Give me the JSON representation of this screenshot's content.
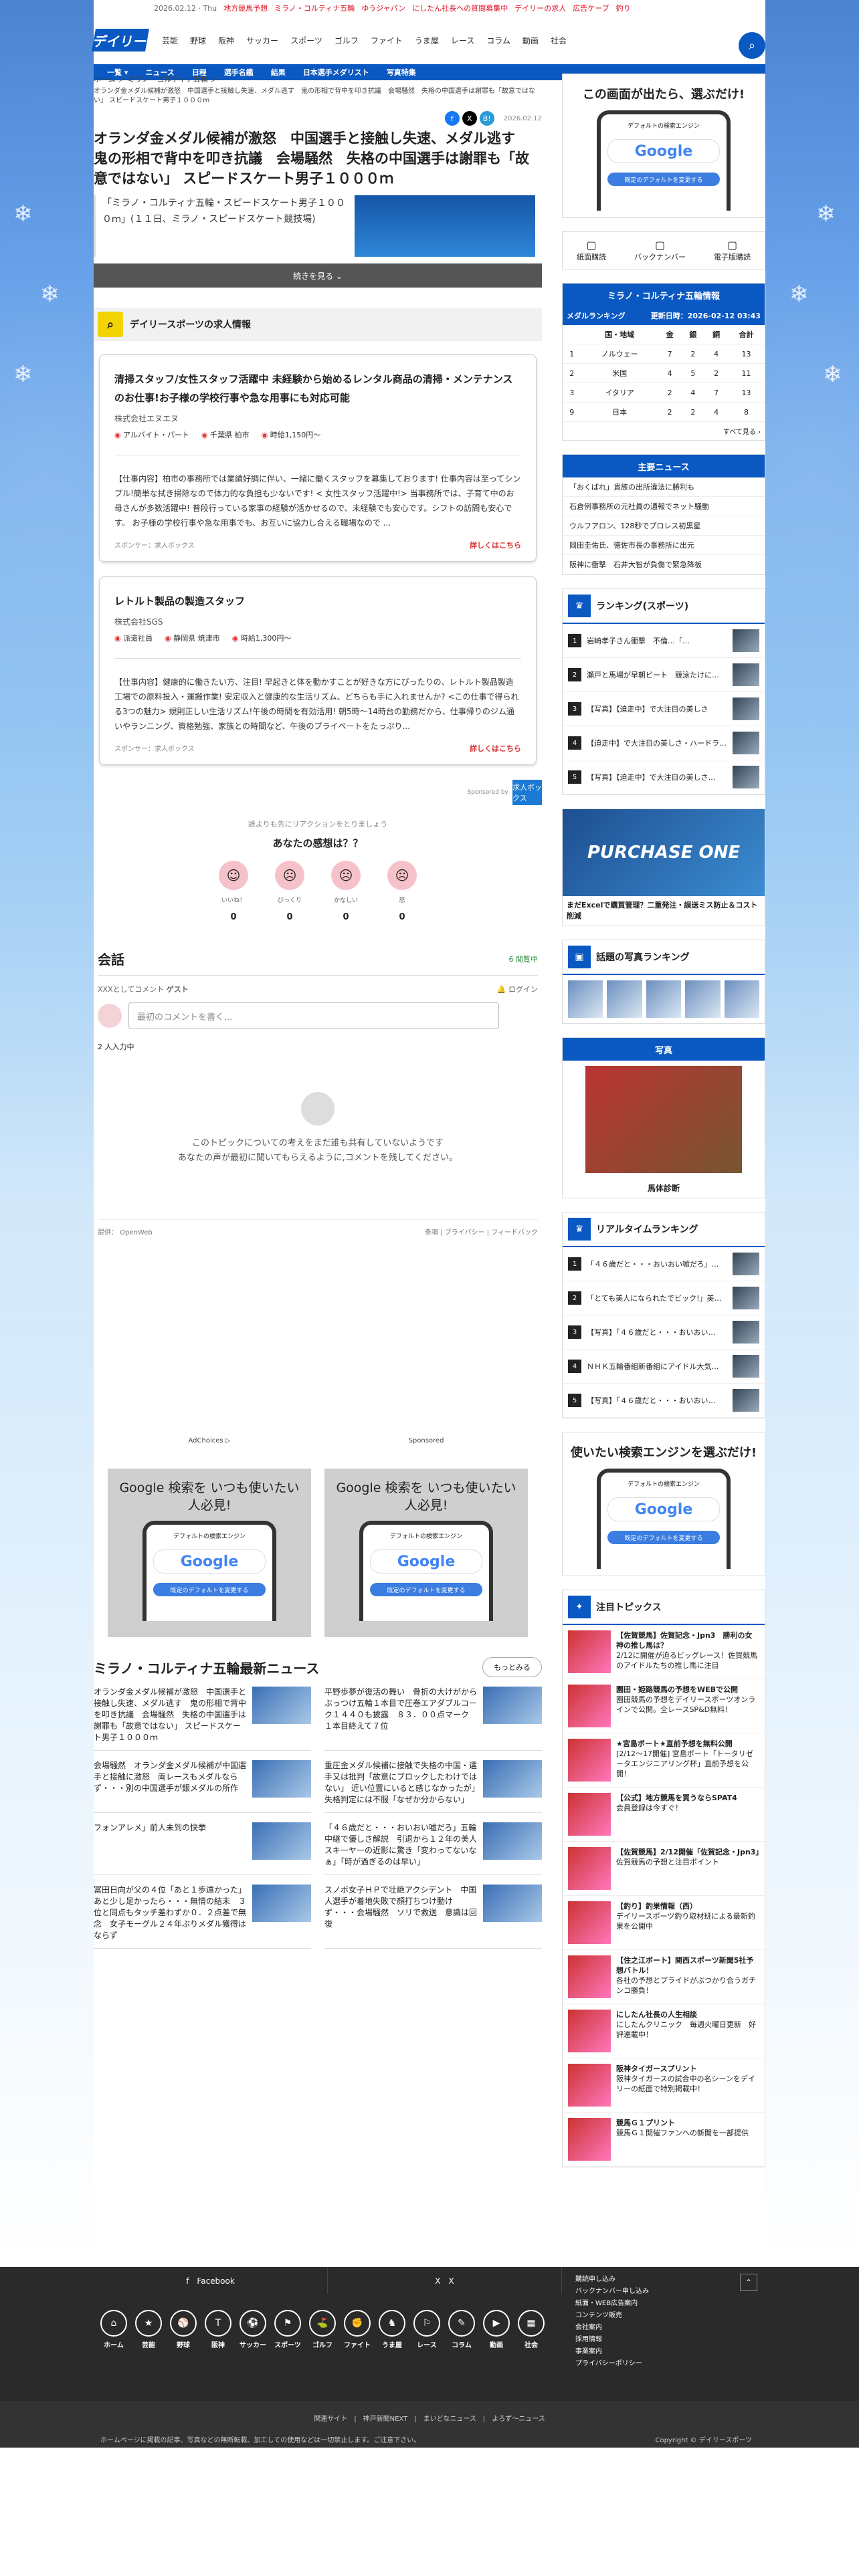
{
  "topbar": {
    "date": "2026.02.12 · Thu",
    "links": [
      "地方競馬予想",
      "ミラノ・コルティナ五輪",
      "ゆうジャパン",
      "にしたん社長への質問募集中",
      "デイリーの求人",
      "広告ケーブ",
      "釣り"
    ]
  },
  "header": {
    "logo": "デイリー",
    "nav": [
      "芸能",
      "野球",
      "阪神",
      "サッカー",
      "スポーツ",
      "ゴルフ",
      "ファイト",
      "うま屋",
      "レース",
      "コラム",
      "動画",
      "社会"
    ]
  },
  "subnav": [
    "一覧 ▾",
    "ニュース",
    "日程",
    "選手名鑑",
    "結果",
    "日本選手メダリスト",
    "写真特集"
  ],
  "article": {
    "breadcrumb": "ホーム ＞ ミラノ・コルティナ五輪 ＞",
    "intro": "オランダ金メダル候補が激怒　中国選手と接触し失速、メダル逃す　鬼の形相で背中を叩き抗議　会場騒然　失格の中国選手は謝罪も「故意ではない」 スピードスケート男子１０００ｍ",
    "date": "2026.02.12",
    "title": "オランダ金メダル候補が激怒　中国選手と接触し失速、メダル逃す　鬼の形相で背中を叩き抗議　会場騒然　失格の中国選手は謝罪も「故意ではない」 スピードスケート男子１０００ｍ",
    "lead": "「ミラノ・コルティナ五輪・スピードスケート男子１０００ｍ」(１１日、ミラノ・スピードスケート競技場)",
    "more": "続きを見る ⌄"
  },
  "jobs": {
    "heading": "デイリースポーツの求人情報",
    "items": [
      {
        "title": "清掃スタッフ/女性スタッフ活躍中 未経験から始めるレンタル商品の清掃・メンテナンスのお仕事!お子様の学校行事や急な用事にも対応可能",
        "company": "株式会社エヌエヌ",
        "type": "アルバイト・パート",
        "place": "千葉県 柏市",
        "wage": "時給1,150円〜",
        "desc": "【仕事内容】柏市の事務所では業績好調に伴い、一緒に働くスタッフを募集しております! 仕事内容は至ってシンプル!簡単な拭き掃除なので体力的な負担も少ないです! < 女性スタッフ活躍中!> 当事務所では、子育て中のお母さんが多数活躍中! 普段行っている家事の経験が活かせるので、未経験でも安心です。シフトの訪問も安心です。 お子様の学校行事や急な用事でも、お互いに協力し合える職場なので ...",
        "sponsor": "スポンサー：求人ボックス",
        "more": "詳しくはこちら"
      },
      {
        "title": "レトルト製品の製造スタッフ",
        "company": "株式会社SGS",
        "type": "派遣社員",
        "place": "静岡県 焼津市",
        "wage": "時給1,300円〜",
        "desc": "【仕事内容】健康的に働きたい方、注目! 早起きと体を動かすことが好きな方にぴったりの、レトルト製品製造工場での原料投入・運搬作業! 安定収入と健康的な生活リズム、どちらも手に入れませんか? <この仕事で得られる3つの魅力> 規則正しい生活リズム!午後の時間を有効活用! 朝5時〜14時台の勤務だから、仕事帰りのジム通いやランニング、資格勉強、家族との時間など、午後のプライベートをたっぷり...",
        "sponsor": "スポンサー：求人ボックス",
        "more": "詳しくはこちら"
      }
    ],
    "sponsored": "Sponsored by",
    "badge": "求人ボックス"
  },
  "reactions": {
    "sub": "誰よりも先にリアクションをとりましょう",
    "title": "あなたの感想は？？",
    "items": [
      {
        "label": "いいね！",
        "count": "0"
      },
      {
        "label": "びっくり",
        "count": "0"
      },
      {
        "label": "かなしい",
        "count": "0"
      },
      {
        "label": "怒",
        "count": "0"
      }
    ]
  },
  "comments": {
    "title": "会話",
    "count": "6 閲覧中",
    "as": "XXXとしてコメント",
    "guest": "ゲスト",
    "login": "ログイン",
    "placeholder": "最初のコメントを書く...",
    "typing": "2 人入力中",
    "empty1": "このトピックについての考えをまだ誰も共有していないようです",
    "empty2": "あなたの声が最初に聞いてもらえるように,コメントを残してください。",
    "provider": "提供： OpenWeb",
    "terms": "条項 | プライバシー | フィードバック"
  },
  "ads": {
    "adchoices": "AdChoices ▷",
    "sponsored": "Sponsored",
    "ad_title": "Google 検索を いつも使いたい人必見!",
    "phone_top": "デフォルトの検索エンジン",
    "google": "Google",
    "phone_btn": "既定のデフォルトを変更する"
  },
  "news": {
    "title": "ミラノ・コルティナ五輪最新ニュース",
    "more": "もっとみる",
    "items": [
      "オランダ金メダル候補が激怒　中国選手と接触し失速、メダル逃す　鬼の形相で背中を叩き抗議　会場騒然　失格の中国選手は謝罪も「故意ではない」 スピードスケート男子１０００ｍ",
      "平野歩夢が復活の舞い　骨折の大けがからぶっつけ五輪１本目で圧巻エアダブルコーク１４４０も披露　８３．００点マーク　１本目終えて７位",
      "会場騒然　オランダ金メダル候補が中国選手と接触に激怒　両レースもメダルならず・・・別の中国選手が銀メダルの所作",
      "重圧金メダル候補に接触で失格の中国・選手又は批判「故意にブロックしたわけではない」 近い位置にいると感じなかったが」失格判定には不服「なぜか分からない」",
      "フォンアレメ」前人未到の快挙",
      "「４６歳だと・・・おいおい嘘だろ」五輪中継で優しさ解説　引退から１２年の美人スキーヤーの近影に驚き「変わってないなぁ」「時が過ぎるのは早い」",
      "冨田日向が父の４位「あと１歩遠かった」あと少し足かったら・・・無情の結末　３位と同点もタッチ差わずか０．２点差で無念　女子モーグル２４年ぶりメダル獲得はならず",
      "スノボ女子ＨＰで壮絶アクシデント　中国人選手が着地失敗で顔打ちつけ動けず・・・会場騒然　ソリで救送　意識は回復"
    ]
  },
  "side": {
    "adq": "この画面が出たら、選ぶだけ!",
    "links": [
      "紙面購読",
      "バックナンバー",
      "電子版購読"
    ],
    "medal_head": "ミラノ・コルティナ五輪情報",
    "medal_title": "メダルランキング",
    "medal_date": "更新日時：2026-02-12 03:43",
    "medal_cols": [
      "国・地域",
      "金",
      "銀",
      "銅",
      "合計"
    ],
    "medals": [
      [
        "1",
        "ノルウェー",
        "7",
        "2",
        "4",
        "13"
      ],
      [
        "2",
        "米国",
        "4",
        "5",
        "2",
        "11"
      ],
      [
        "3",
        "イタリア",
        "2",
        "4",
        "7",
        "13"
      ],
      [
        "9",
        "日本",
        "2",
        "2",
        "4",
        "8"
      ]
    ],
    "medal_all": "すべて見る ›",
    "main_news": "主要ニュース",
    "news": [
      "「おくばれ」貴族の出所違法に勝利も",
      "石倉例事務所の元社員の通報でネット騒動",
      "ウルフアロン、128秒でプロレス初黒星",
      "岡田圭佑氏、徳佐市長の事務所に出元",
      "阪神に衝撃　石井大智が負傷で緊急降板"
    ],
    "rank_title": "ランキング(スポーツ)",
    "rank": [
      "岩崎孝子さん衝撃　不倫…「…",
      "瀬戸と馬場が早朝ビート　競泳たけに…",
      "【写真】【迫走中】で大注目の美しさ",
      "【迫走中】で大注目の美しさ・ハードラ…",
      "【写真】【迫走中】で大注目の美しさ…"
    ],
    "promo": "PURCHASE ONE",
    "promo_t": "まだExcelで購買管理？二重発注・誤送ミス防止＆コスト削減",
    "photo_title": "話題の写真ランキング",
    "photo_box": "写真",
    "horse": "馬体診断",
    "rt_title": "リアルタイムランキング",
    "rt": [
      "「４６歳だと・・・おいおい嘘だろ」…",
      "「とても美人になられたでビック!」美…",
      "【写真】「４６歳だと・・・おいおい…",
      "ＮＨＫ五輪番組新番組にアイドル大気…",
      "【写真】「４６歳だと・・・おいおい…"
    ],
    "adq2": "使いたい検索エンジンを選ぶだけ!",
    "topics_title": "注目トピックス",
    "topics": [
      [
        "【佐賀競馬】佐賀記念・Jpn3　勝利の女神の推し馬は？",
        "2/12に開催が迫るビッグレース！佐賀競馬のアイドルたちの推し馬に注目"
      ],
      [
        "園田・姫路競馬の予想をWEBで公開",
        "園田競馬の予想をデイリースポーツオンラインで公開。全レースSP&D無料！"
      ],
      [
        "★宮島ボート★直前予想を無料公開",
        "[2/12〜17開催] 宮島ボート「トータリゼータエンジニアリング杯」直前予想を公開！"
      ],
      [
        "【公式】地方競馬を買うならSPAT4",
        "会員登録は今すぐ！"
      ],
      [
        "【佐賀競馬】2/12開催「佐賀記念・Jpn3」",
        "佐賀競馬の予想と注目ポイント"
      ],
      [
        "【釣り】釣果情報（西）",
        "デイリースポーツ釣り取材班による最新釣果を公開中"
      ],
      [
        "【住之江ボート】関西スポーツ新聞5社予想バトル！",
        "各社の予想とプライドがぶつかり合うガチンコ勝負！"
      ],
      [
        "にしたん社長の人生相談",
        "にしたんクリニック　毎週火曜日更新　好評連載中！"
      ],
      [
        "阪神タイガースプリント",
        "阪神タイガースの試合中の名シーンをデイリーの紙面で特別掲載中！"
      ],
      [
        "競馬Ｇ１プリント",
        "競馬Ｇ１開催ファンへの新聞を一部提供"
      ]
    ]
  },
  "footer": {
    "social": [
      "f　Facebook",
      "X　X"
    ],
    "icons": [
      "ホーム",
      "芸能",
      "野球",
      "阪神",
      "サッカー",
      "スポーツ",
      "ゴルフ",
      "ファイト",
      "うま屋",
      "レース",
      "コラム",
      "動画",
      "社会"
    ],
    "links": [
      "購読申し込み",
      "バックナンバー申し込み",
      "紙面・WEB広告案内",
      "コンテンツ販売",
      "会社案内",
      "採用情報",
      "事業案内",
      "プライバシーポリシー"
    ],
    "bar": "関連サイト　|　神戸新聞NEXT　|　まいどなニュース　|　よろず〜ニュース",
    "copy": "ホームページに掲載の記事、写真などの無断転載、加工しての使用などは一切禁止します。ご注意下さい。",
    "copy2": "Copyright © デイリースポーツ"
  }
}
